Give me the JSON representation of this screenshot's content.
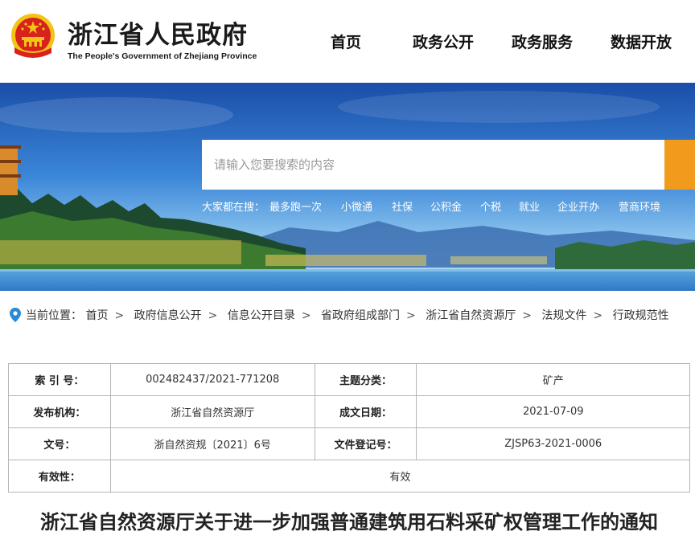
{
  "header": {
    "brand_cn": "浙江省人民政府",
    "brand_en": "The People's Government of Zhejiang Province",
    "nav": [
      "首页",
      "政务公开",
      "政务服务",
      "数据开放"
    ]
  },
  "banner": {
    "search_placeholder": "请输入您要搜索的内容",
    "hot_label": "大家都在搜：",
    "hot_items": [
      "最多跑一次",
      "小微通",
      "社保",
      "公积金",
      "个税",
      "就业",
      "企业开办",
      "营商环境"
    ],
    "search_button_color": "#f29a1c"
  },
  "breadcrumb": {
    "label": "当前位置：",
    "items": [
      "首页",
      "政府信息公开",
      "信息公开目录",
      "省政府组成部门",
      "浙江省自然资源厅",
      "法规文件",
      "行政规范性"
    ]
  },
  "meta": {
    "rows": [
      {
        "l1": "索 引 号：",
        "v1": "002482437/2021-771208",
        "l2": "主题分类：",
        "v2": "矿产"
      },
      {
        "l1": "发布机构：",
        "v1": "浙江省自然资源厅",
        "l2": "成文日期：",
        "v2": "2021-07-09"
      },
      {
        "l1": "文号：",
        "v1": "浙自然资规〔2021〕6号",
        "l2": "文件登记号：",
        "v2": "ZJSP63-2021-0006"
      }
    ],
    "validity_label": "有效性：",
    "validity_value": "有效"
  },
  "document": {
    "title": "浙江省自然资源厅关于进一步加强普通建筑用石料采矿权管理工作的通知"
  }
}
